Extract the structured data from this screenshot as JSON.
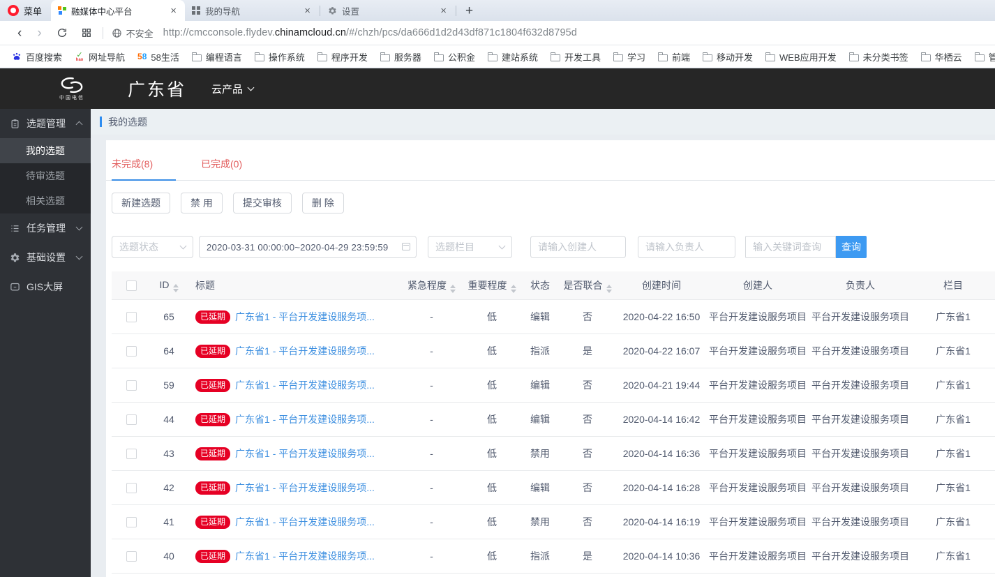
{
  "browser": {
    "menu": {
      "label": "菜单"
    },
    "tabs": [
      {
        "title": "融媒体中心平台",
        "favicon": "cmc-squares",
        "active": true
      },
      {
        "title": "我的导航",
        "favicon": "grid",
        "active": false
      },
      {
        "title": "设置",
        "favicon": "gear",
        "active": false
      }
    ],
    "new_tab_label": "+",
    "close_glyph": "×",
    "address": {
      "security": "不安全",
      "url_prefix": "http://cmcconsole.flydev.",
      "url_domain": "chinamcloud.cn",
      "url_path": "/#/chzh/pcs/da666d1d2d43df871c1804f632d8795d"
    },
    "bookmarks": [
      {
        "label": "百度搜索",
        "icon": "baidu"
      },
      {
        "label": "网址导航",
        "icon": "hao123"
      },
      {
        "label": "58生活",
        "icon": "site58"
      },
      {
        "label": "编程语言",
        "icon": "folder"
      },
      {
        "label": "操作系统",
        "icon": "folder"
      },
      {
        "label": "程序开发",
        "icon": "folder"
      },
      {
        "label": "服务器",
        "icon": "folder"
      },
      {
        "label": "公积金",
        "icon": "folder"
      },
      {
        "label": "建站系统",
        "icon": "folder"
      },
      {
        "label": "开发工具",
        "icon": "folder"
      },
      {
        "label": "学习",
        "icon": "folder"
      },
      {
        "label": "前端",
        "icon": "folder"
      },
      {
        "label": "移动开发",
        "icon": "folder"
      },
      {
        "label": "WEB应用开发",
        "icon": "folder"
      },
      {
        "label": "未分类书签",
        "icon": "folder"
      },
      {
        "label": "华栖云",
        "icon": "folder"
      },
      {
        "label": "管理和监控",
        "icon": "folder"
      }
    ]
  },
  "app": {
    "brand": "中国电信",
    "region": "广东省",
    "product_menu": "云产品"
  },
  "sidebar": {
    "items": [
      {
        "label": "选题管理",
        "icon": "clipboard",
        "expanded": true,
        "children": [
          {
            "label": "我的选题",
            "active": true
          },
          {
            "label": "待审选题",
            "active": false
          },
          {
            "label": "相关选题",
            "active": false
          }
        ]
      },
      {
        "label": "任务管理",
        "icon": "tasks",
        "expanded": false
      },
      {
        "label": "基础设置",
        "icon": "gear",
        "expanded": false
      },
      {
        "label": "GIS大屏",
        "icon": "screen"
      }
    ]
  },
  "page": {
    "breadcrumb": "我的选题",
    "tabs": [
      {
        "label": "未完成(8)",
        "active": true
      },
      {
        "label": "已完成(0)",
        "active": false
      }
    ],
    "toolbar": [
      {
        "label": "新建选题"
      },
      {
        "label": "禁 用"
      },
      {
        "label": "提交审核"
      },
      {
        "label": "删 除"
      }
    ],
    "filters": {
      "status_placeholder": "选题状态",
      "date_range": "2020-03-31 00:00:00~2020-04-29 23:59:59",
      "category_placeholder": "选题栏目",
      "creator_placeholder": "请输入创建人",
      "owner_placeholder": "请输入负责人",
      "keyword_placeholder": "输入关键词查询",
      "search_label": "查询"
    },
    "table": {
      "badge_label": "已延期",
      "columns": [
        {
          "label": "ID",
          "sortable": true
        },
        {
          "label": "标题",
          "sortable": false,
          "align": "left"
        },
        {
          "label": "紧急程度",
          "sortable": true
        },
        {
          "label": "重要程度",
          "sortable": true
        },
        {
          "label": "状态",
          "sortable": false
        },
        {
          "label": "是否联合",
          "sortable": true
        },
        {
          "label": "创建时间",
          "sortable": false
        },
        {
          "label": "创建人",
          "sortable": false
        },
        {
          "label": "负责人",
          "sortable": false
        },
        {
          "label": "栏目",
          "sortable": false
        }
      ],
      "rows": [
        {
          "id": "65",
          "title": "广东省1 - 平台开发建设服务项...",
          "urgency": "-",
          "importance": "低",
          "status": "编辑",
          "joint": "否",
          "created_at": "2020-04-22 16:50",
          "creator": "平台开发建设服务项目",
          "owner": "平台开发建设服务项目",
          "column": "广东省1"
        },
        {
          "id": "64",
          "title": "广东省1 - 平台开发建设服务项...",
          "urgency": "-",
          "importance": "低",
          "status": "指派",
          "joint": "是",
          "created_at": "2020-04-22 16:07",
          "creator": "平台开发建设服务项目",
          "owner": "平台开发建设服务项目",
          "column": "广东省1"
        },
        {
          "id": "59",
          "title": "广东省1 - 平台开发建设服务项...",
          "urgency": "-",
          "importance": "低",
          "status": "编辑",
          "joint": "否",
          "created_at": "2020-04-21 19:44",
          "creator": "平台开发建设服务项目",
          "owner": "平台开发建设服务项目",
          "column": "广东省1"
        },
        {
          "id": "44",
          "title": "广东省1 - 平台开发建设服务项...",
          "urgency": "-",
          "importance": "低",
          "status": "编辑",
          "joint": "否",
          "created_at": "2020-04-14 16:42",
          "creator": "平台开发建设服务项目",
          "owner": "平台开发建设服务项目",
          "column": "广东省1"
        },
        {
          "id": "43",
          "title": "广东省1 - 平台开发建设服务项...",
          "urgency": "-",
          "importance": "低",
          "status": "禁用",
          "joint": "否",
          "created_at": "2020-04-14 16:36",
          "creator": "平台开发建设服务项目",
          "owner": "平台开发建设服务项目",
          "column": "广东省1"
        },
        {
          "id": "42",
          "title": "广东省1 - 平台开发建设服务项...",
          "urgency": "-",
          "importance": "低",
          "status": "编辑",
          "joint": "否",
          "created_at": "2020-04-14 16:28",
          "creator": "平台开发建设服务项目",
          "owner": "平台开发建设服务项目",
          "column": "广东省1"
        },
        {
          "id": "41",
          "title": "广东省1 - 平台开发建设服务项...",
          "urgency": "-",
          "importance": "低",
          "status": "禁用",
          "joint": "否",
          "created_at": "2020-04-14 16:19",
          "creator": "平台开发建设服务项目",
          "owner": "平台开发建设服务项目",
          "column": "广东省1"
        },
        {
          "id": "40",
          "title": "广东省1 - 平台开发建设服务项...",
          "urgency": "-",
          "importance": "低",
          "status": "指派",
          "joint": "是",
          "created_at": "2020-04-14 10:36",
          "creator": "平台开发建设服务项目",
          "owner": "平台开发建设服务项目",
          "column": "广东省1"
        }
      ]
    }
  },
  "colors": {
    "accent_blue": "#3a8ee6",
    "primary_button_blue": "#3d9af2",
    "tab_red": "#e25d5d",
    "badge_red": "#e60024",
    "link_blue": "#3d8fe0",
    "header_dark": "#262626",
    "sidebar_dark": "#2e3136",
    "opera_red": "#ff1b2d"
  }
}
